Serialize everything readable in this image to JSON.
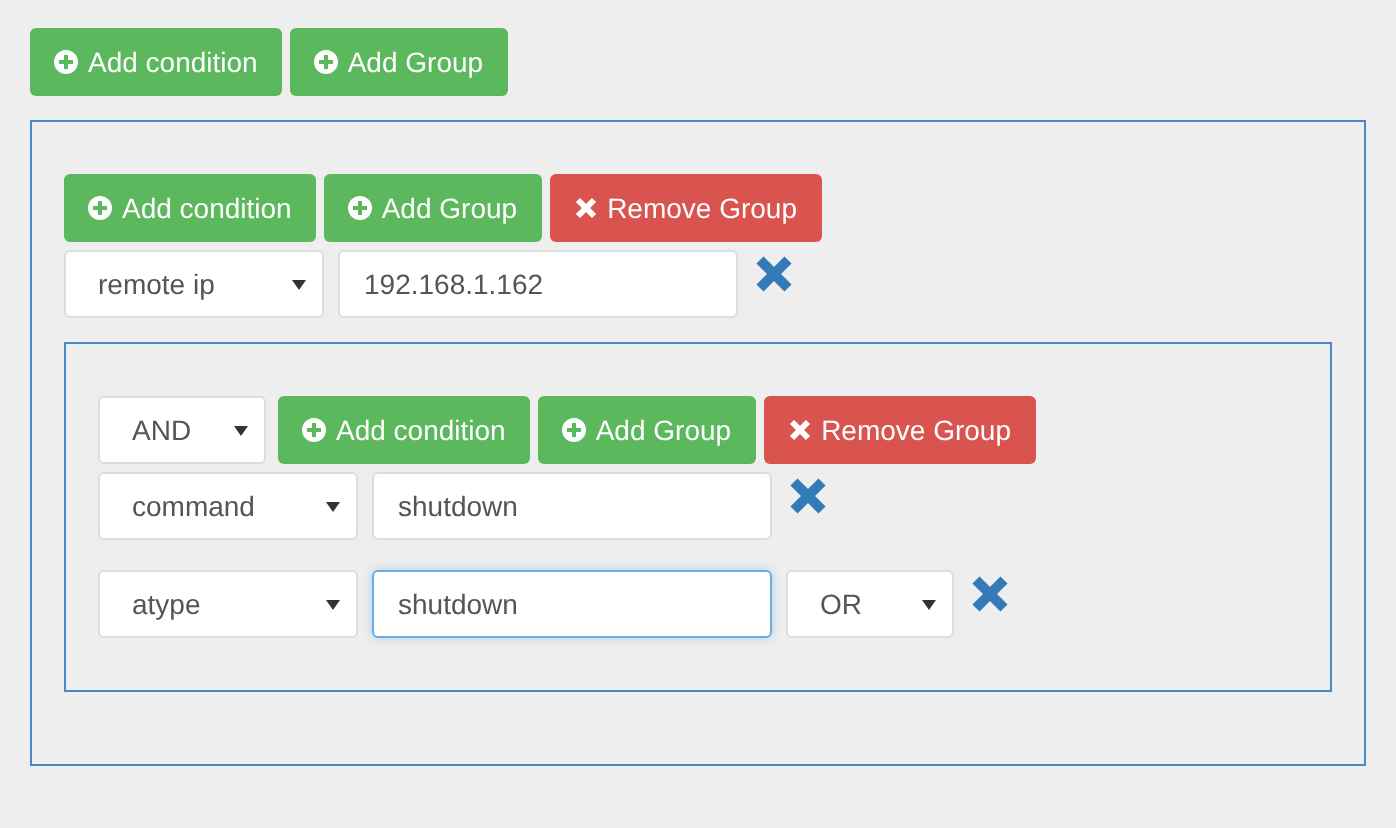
{
  "toolbar": {
    "buttons": [
      {
        "kind": "add",
        "label": "Add condition"
      },
      {
        "kind": "add",
        "label": "Add Group"
      }
    ]
  },
  "group": {
    "buttons": [
      {
        "kind": "add",
        "label": "Add condition"
      },
      {
        "kind": "add",
        "label": "Add Group"
      },
      {
        "kind": "remove",
        "label": "Remove Group"
      }
    ],
    "conditions": [
      {
        "field": "remote ip",
        "value": "192.168.1.162",
        "focused": false
      }
    ],
    "groups": [
      {
        "operator": "AND",
        "buttons": [
          {
            "kind": "add",
            "label": "Add condition"
          },
          {
            "kind": "add",
            "label": "Add Group"
          },
          {
            "kind": "remove",
            "label": "Remove Group"
          }
        ],
        "conditions": [
          {
            "field": "command",
            "value": "shutdown",
            "focused": false
          },
          {
            "field": "atype",
            "value": "shutdown",
            "focused": true,
            "operator": "OR"
          }
        ]
      }
    ]
  }
}
